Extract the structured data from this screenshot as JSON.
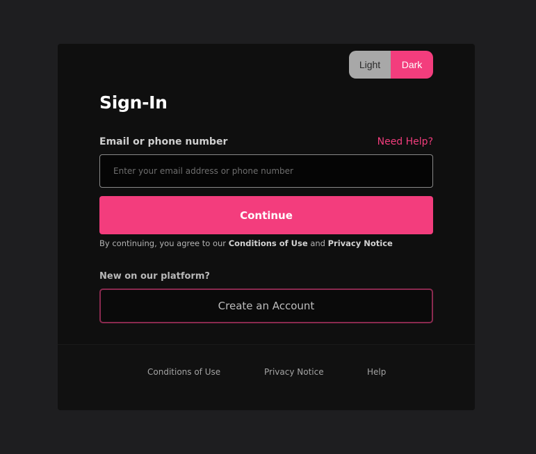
{
  "theme": {
    "light_label": "Light",
    "dark_label": "Dark",
    "selected": "Dark"
  },
  "form": {
    "title": "Sign-In",
    "email_label": "Email or phone number",
    "help_link": "Need Help?",
    "email_placeholder": "Enter your email address or phone number",
    "email_value": "",
    "continue_label": "Continue",
    "terms_prefix": "By continuing, you agree to our ",
    "terms_conditions": "Conditions of Use",
    "terms_and": " and ",
    "terms_privacy": "Privacy Notice",
    "new_label": "New on our platform?",
    "create_label": "Create an Account"
  },
  "footer": {
    "links": [
      "Conditions of Use",
      "Privacy Notice",
      "Help"
    ]
  },
  "colors": {
    "accent": "#f33d7d",
    "background": "#1e1e20",
    "card": "#0f0f0f"
  }
}
